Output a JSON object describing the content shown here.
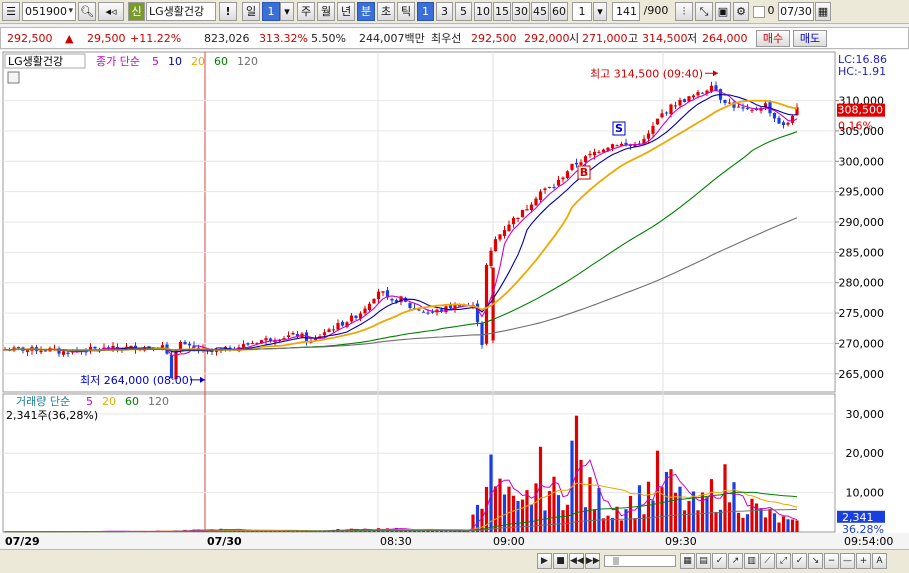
{
  "toolbar": {
    "code": "051900",
    "stock_name": "LG생활건강",
    "mark": "신",
    "alert": "!",
    "period_day": "일",
    "period_num": "1",
    "periods": [
      "주",
      "월",
      "년",
      "분",
      "초",
      "틱"
    ],
    "intervals": [
      "1",
      "3",
      "5",
      "10",
      "15",
      "30",
      "45",
      "60"
    ],
    "interval_input": "1",
    "count": "141",
    "count_total": "/900",
    "zero_flag": "0",
    "date": "07/30"
  },
  "info": {
    "price": "292,500",
    "change": "29,500",
    "change_pct": "+11.22%",
    "volume": "823,026",
    "volume_ratio": "313.32%",
    "turnover_ratio": "5.50%",
    "amount": "244,007백만",
    "best_label": "최우선",
    "ask": "292,500",
    "bid": "292,000",
    "open_label": "시",
    "open": "271,000",
    "high_label": "고",
    "high": "314,500",
    "low_label": "저",
    "low": "264,000",
    "buy_button": "매수",
    "sell_button": "매도"
  },
  "price_panel": {
    "title": "LG생활건강",
    "ma_label": "종가 단순",
    "ma_periods": [
      "5",
      "10",
      "20",
      "60",
      "120"
    ],
    "lc_label": "LC:16.86",
    "hc_label": "HC:-1.91",
    "current_price_tag": "308,500",
    "current_pct_tag": "0.16%",
    "high_annotation": "최고 314,500 (09:40)",
    "low_annotation": "최저 264,000 (08:00)",
    "signal_s": "S",
    "signal_b": "B",
    "y_ticks": [
      "310,000",
      "305,000",
      "300,000",
      "295,000",
      "290,000",
      "285,000",
      "280,000",
      "275,000",
      "270,000",
      "265,000"
    ]
  },
  "volume_panel": {
    "label": "거래량 단순",
    "ma_periods": [
      "5",
      "20",
      "60",
      "120"
    ],
    "current_text": "2,341주(36,28%)",
    "current_tag": "2,341",
    "current_pct_tag": "36,28%",
    "y_ticks": [
      "30,000",
      "20,000",
      "10,000"
    ]
  },
  "x_axis": {
    "labels": [
      "07/29",
      "07/30",
      "08:30",
      "09:00",
      "09:30"
    ],
    "end_time": "09:54:00"
  },
  "colors": {
    "up": "#e00000",
    "down": "#1a3fe0",
    "ma5": "#cc00cc",
    "ma10": "#0000aa",
    "ma20": "#f0a800",
    "ma60": "#008000",
    "ma120": "#707070"
  },
  "chart_data": {
    "type": "candlestick",
    "title": "LG생활건강",
    "y_unit": "KRW",
    "ylim": [
      262000,
      318000
    ],
    "grid": true,
    "key_points": [
      {
        "label": "최고",
        "value": 314500,
        "time": "09:40"
      },
      {
        "label": "최저",
        "value": 264000,
        "time": "08:00"
      }
    ],
    "price_path": [
      [
        0,
        269000
      ],
      [
        50,
        269000
      ],
      [
        60,
        268500
      ],
      [
        90,
        269000
      ],
      [
        130,
        269300
      ],
      [
        165,
        269500
      ],
      [
        172,
        264000
      ],
      [
        174,
        268000
      ],
      [
        178,
        270500
      ],
      [
        185,
        269500
      ],
      [
        210,
        268500
      ],
      [
        240,
        269500
      ],
      [
        260,
        270500
      ],
      [
        280,
        271000
      ],
      [
        300,
        271500
      ],
      [
        310,
        270000
      ],
      [
        325,
        272000
      ],
      [
        345,
        273500
      ],
      [
        360,
        275000
      ],
      [
        375,
        278000
      ],
      [
        380,
        279000
      ],
      [
        390,
        276500
      ],
      [
        400,
        277500
      ],
      [
        410,
        276000
      ],
      [
        430,
        275000
      ],
      [
        460,
        276500
      ],
      [
        475,
        276000
      ],
      [
        482,
        270000
      ],
      [
        486,
        282500
      ],
      [
        495,
        287000
      ],
      [
        510,
        290000
      ],
      [
        525,
        292000
      ],
      [
        540,
        295000
      ],
      [
        555,
        296000
      ],
      [
        570,
        299000
      ],
      [
        585,
        300500
      ],
      [
        600,
        302000
      ],
      [
        615,
        303000
      ],
      [
        630,
        302500
      ],
      [
        645,
        303500
      ],
      [
        660,
        307500
      ],
      [
        675,
        309500
      ],
      [
        690,
        310500
      ],
      [
        705,
        311500
      ],
      [
        712,
        313000
      ],
      [
        720,
        310500
      ],
      [
        735,
        309000
      ],
      [
        750,
        308000
      ],
      [
        765,
        309500
      ],
      [
        775,
        307000
      ],
      [
        785,
        305500
      ],
      [
        795,
        308500
      ]
    ],
    "volume_path": [
      [
        0,
        60
      ],
      [
        170,
        300
      ],
      [
        220,
        700
      ],
      [
        300,
        200
      ],
      [
        375,
        1000
      ],
      [
        470,
        200
      ],
      [
        485,
        20000
      ],
      [
        500,
        12000
      ],
      [
        520,
        6000
      ],
      [
        540,
        17000
      ],
      [
        560,
        9000
      ],
      [
        575,
        30000
      ],
      [
        585,
        12000
      ],
      [
        610,
        7000
      ],
      [
        640,
        10000
      ],
      [
        660,
        17000
      ],
      [
        680,
        10000
      ],
      [
        700,
        7000
      ],
      [
        720,
        15000
      ],
      [
        760,
        6000
      ],
      [
        795,
        2341
      ]
    ]
  }
}
